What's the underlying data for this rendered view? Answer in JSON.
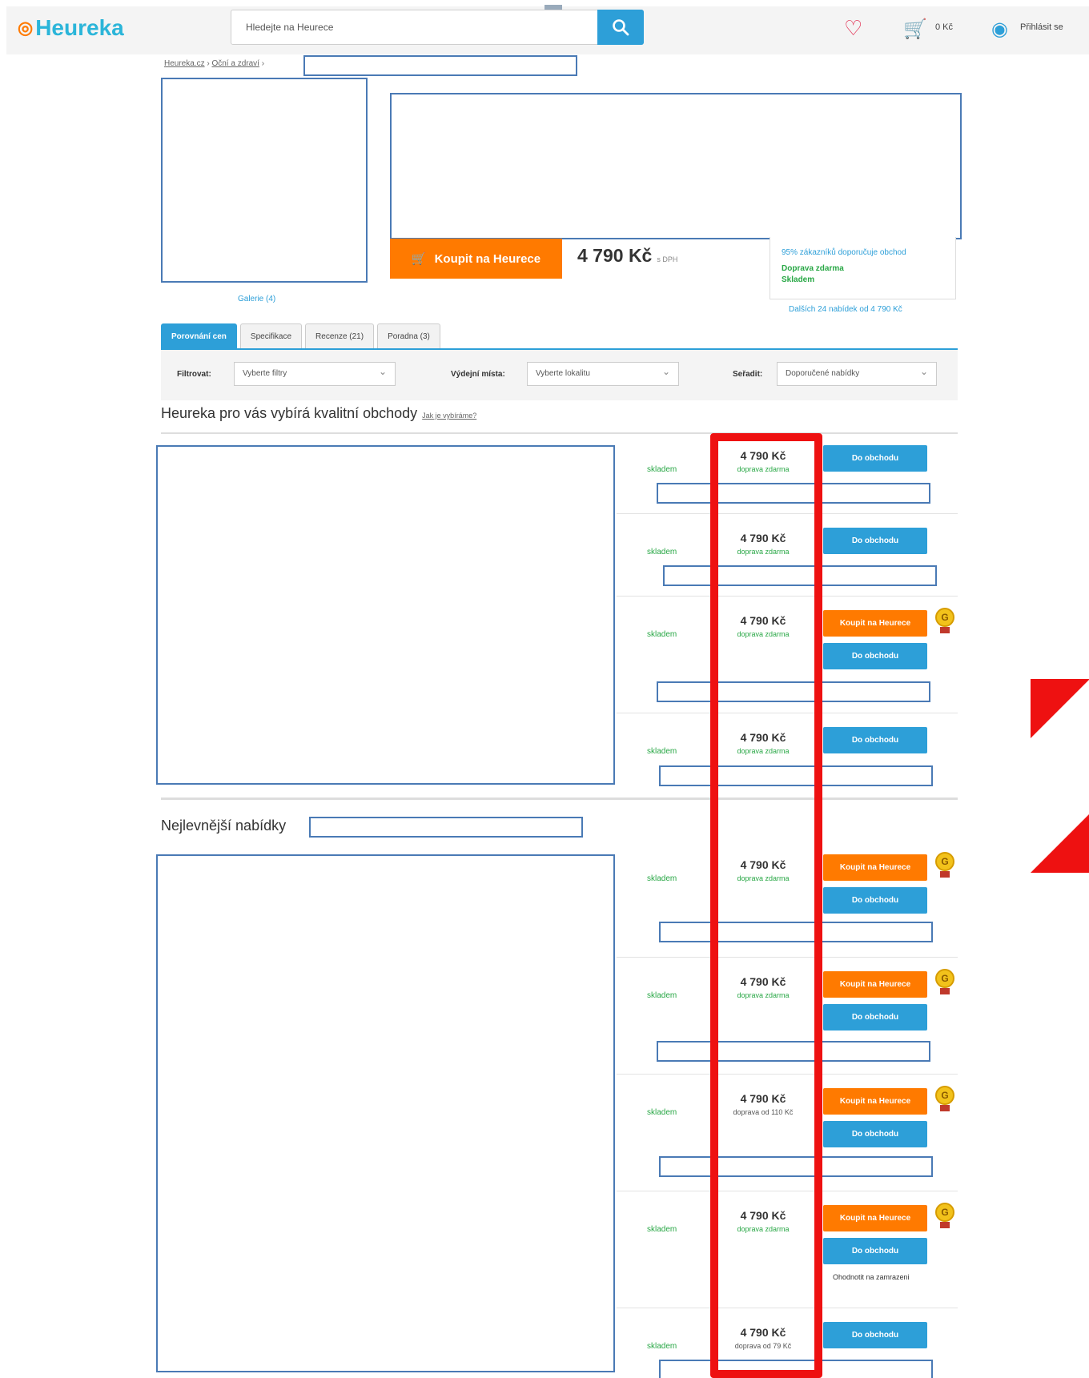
{
  "header": {
    "logo": "Heureka",
    "search_placeholder": "Hledejte na Heurece",
    "cart_price": "0 Kč",
    "login_label": "Přihlásit se"
  },
  "breadcrumb": {
    "home": "Heureka.cz",
    "category": "Oční a zdraví"
  },
  "product": {
    "gallery_label": "Galerie (4)",
    "buy_label": "Koupit na Heurece",
    "price": "4 790 Kč",
    "price_vat": "s DPH",
    "recommend_text": "95% zákazníků doporučuje obchod",
    "shipping_text": "Doprava zdarma",
    "stock_text": "Skladem",
    "more_offers": "Dalších 24 nabídek od 4 790 Kč"
  },
  "tabs": [
    {
      "label": "Porovnání cen",
      "active": true
    },
    {
      "label": "Specifikace",
      "active": false
    },
    {
      "label": "Recenze (21)",
      "active": false
    },
    {
      "label": "Poradna (3)",
      "active": false
    }
  ],
  "filters": {
    "filter_label": "Filtrovat:",
    "filter_value": "Vyberte filtry",
    "pickup_label": "Výdejní místa:",
    "pickup_value": "Vyberte lokalitu",
    "sort_label": "Seřadit:",
    "sort_value": "Doporučené nabídky"
  },
  "section_quality": {
    "title": "Heureka pro vás vybírá kvalitní obchody",
    "link": "Jak je vybíráme?"
  },
  "section_cheapest": {
    "title": "Nejlevnější nabídky"
  },
  "labels": {
    "in_stock": "skladem",
    "go_to_shop": "Do obchodu",
    "buy_on_heureka": "Koupit na Heurece",
    "badge_letter": "G",
    "note_rate": "Ohodnotit na zamrazeni"
  },
  "offers_quality": [
    {
      "price": "4 790 Kč",
      "delivery": "doprava zdarma",
      "buy": false
    },
    {
      "price": "4 790 Kč",
      "delivery": "doprava zdarma",
      "buy": false
    },
    {
      "price": "4 790 Kč",
      "delivery": "doprava zdarma",
      "buy": true
    },
    {
      "price": "4 790 Kč",
      "delivery": "doprava zdarma",
      "buy": false
    }
  ],
  "offers_cheapest": [
    {
      "price": "4 790 Kč",
      "delivery": "doprava zdarma",
      "buy": true
    },
    {
      "price": "4 790 Kč",
      "delivery": "doprava zdarma",
      "buy": true
    },
    {
      "price": "4 790 Kč",
      "delivery": "doprava od 110 Kč",
      "buy": true
    },
    {
      "price": "4 790 Kč",
      "delivery": "doprava zdarma",
      "buy": true
    },
    {
      "price": "4 790 Kč",
      "delivery": "doprava od 79 Kč",
      "buy": false
    }
  ],
  "colors": {
    "accent": "#2d9fd8",
    "buy": "#ff7a00",
    "highlight": "#ee1111",
    "success": "#28a745"
  }
}
